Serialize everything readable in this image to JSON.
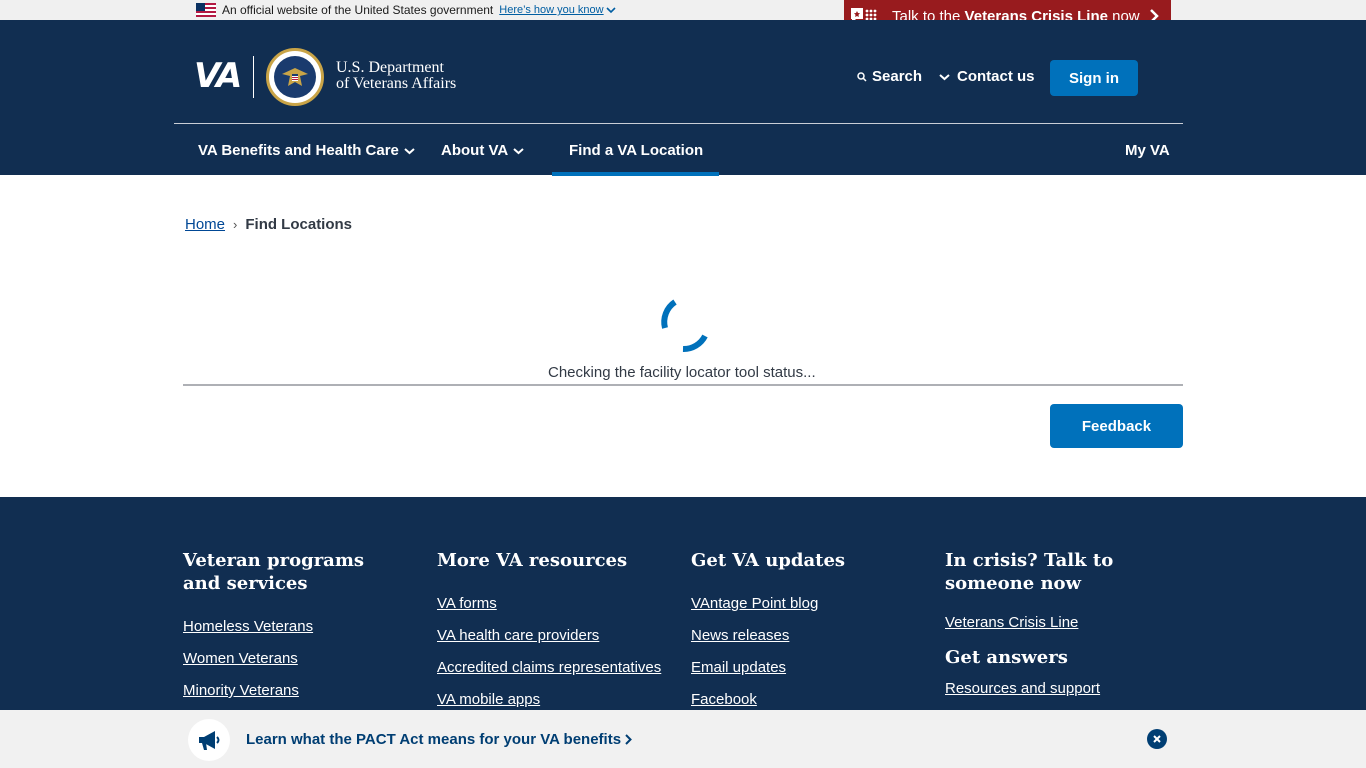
{
  "gov_banner": {
    "text": "An official website of the United States government",
    "link": "Here’s how you know"
  },
  "crisis_line": {
    "prefix": "Talk to the ",
    "bold": "Veterans Crisis Line",
    "suffix": " now"
  },
  "header": {
    "logo": "VA",
    "dept_line1": "U.S. Department",
    "dept_line2": "of Veterans Affairs",
    "search_label": "Search",
    "contact_label": "Contact us",
    "signin_label": "Sign in"
  },
  "nav": {
    "items": [
      {
        "label": "VA Benefits and Health Care",
        "dropdown": true
      },
      {
        "label": "About VA",
        "dropdown": true
      },
      {
        "label": "Find a VA Location",
        "active": true
      },
      {
        "label": "My VA"
      }
    ]
  },
  "breadcrumb": {
    "home": "Home",
    "separator": "›",
    "current": "Find Locations"
  },
  "main": {
    "status": "Checking the facility locator tool status...",
    "feedback_label": "Feedback"
  },
  "footer": {
    "col1": {
      "heading": "Veteran programs and services",
      "links": [
        "Homeless Veterans",
        "Women Veterans",
        "Minority Veterans"
      ]
    },
    "col2": {
      "heading": "More VA resources",
      "links": [
        "VA forms",
        "VA health care providers",
        "Accredited claims representatives",
        "VA mobile apps"
      ]
    },
    "col3": {
      "heading": "Get VA updates",
      "links": [
        "VAntage Point blog",
        "News releases",
        "Email updates",
        "Facebook"
      ]
    },
    "col4": {
      "heading": "In crisis? Talk to someone now",
      "links": [
        "Veterans Crisis Line"
      ],
      "heading2": "Get answers",
      "links2": [
        "Resources and support"
      ]
    }
  },
  "promo": {
    "text": "Learn what the PACT Act means for your VA benefits"
  },
  "colors": {
    "header_bg": "#112e51",
    "accent": "#0071bb",
    "crisis_red": "#981b1e"
  }
}
